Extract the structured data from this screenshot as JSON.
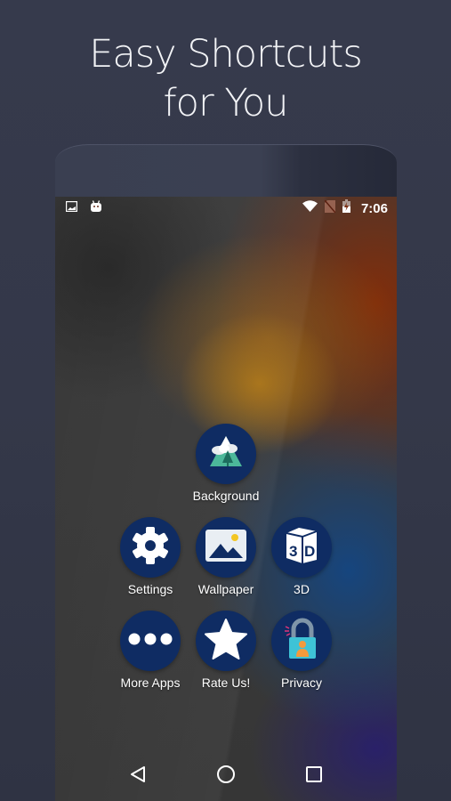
{
  "headline": {
    "line1": "Easy Shortcuts",
    "line2": "for You"
  },
  "status_bar": {
    "left_icons": [
      "image-notification-icon",
      "android-notification-icon"
    ],
    "right_icons": [
      "wifi-icon",
      "no-sim-icon",
      "battery-charging-icon"
    ],
    "time": "7:06"
  },
  "shortcuts": [
    {
      "label": "Background",
      "icon": "mountain-icon"
    },
    {
      "label": "Settings",
      "icon": "gear-icon"
    },
    {
      "label": "Wallpaper",
      "icon": "picture-icon"
    },
    {
      "label": "3D",
      "icon": "3d-cube-icon"
    },
    {
      "label": "More Apps",
      "icon": "more-dots-icon"
    },
    {
      "label": "Rate Us!",
      "icon": "star-icon"
    },
    {
      "label": "Privacy",
      "icon": "padlock-icon"
    }
  ],
  "nav_bar": {
    "buttons": [
      "back",
      "home",
      "recents"
    ]
  },
  "colors": {
    "page_bg": "#363a4c",
    "icon_circle": "#0f2c63",
    "status_accent": "#7f2d0c"
  }
}
